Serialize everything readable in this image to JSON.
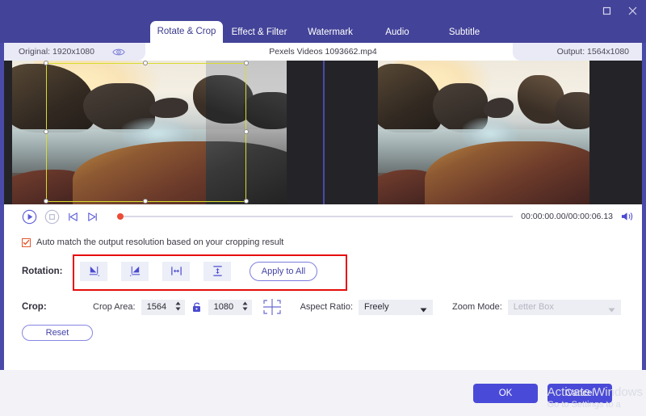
{
  "window": {
    "maximize_label": "Maximize",
    "close_label": "Close"
  },
  "tabs": [
    {
      "label": "Rotate & Crop",
      "active": true
    },
    {
      "label": "Effect & Filter",
      "active": false
    },
    {
      "label": "Watermark",
      "active": false
    },
    {
      "label": "Audio",
      "active": false
    },
    {
      "label": "Subtitle",
      "active": false
    }
  ],
  "preview": {
    "original_label": "Original: 1920x1080",
    "filename": "Pexels Videos 1093662.mp4",
    "output_label": "Output: 1564x1080",
    "eye_icon": "eye-icon"
  },
  "transport": {
    "play_icon": "play-icon",
    "stop_icon": "stop-icon",
    "prev_icon": "previous-frame-icon",
    "next_icon": "next-frame-icon",
    "timecode": "00:00:00.00/00:00:06.13",
    "volume_icon": "volume-icon"
  },
  "settings": {
    "auto_match_label": "Auto match the output resolution based on your cropping result",
    "auto_match_checked": true,
    "rotation_label": "Rotation:",
    "rotation_buttons": [
      {
        "name": "rotate-left-icon",
        "title": "Rotate Left"
      },
      {
        "name": "rotate-right-icon",
        "title": "Rotate Right"
      },
      {
        "name": "flip-horizontal-icon",
        "title": "Horizontal Flip"
      },
      {
        "name": "flip-vertical-icon",
        "title": "Vertical Flip"
      }
    ],
    "apply_to_all_label": "Apply to All",
    "crop_label": "Crop:",
    "crop_area_label": "Crop Area:",
    "crop_width": "1564",
    "crop_height": "1080",
    "lock_icon": "lock-icon",
    "position_icon": "crop-position-icon",
    "aspect_ratio_label": "Aspect Ratio:",
    "aspect_ratio_value": "Freely",
    "zoom_mode_label": "Zoom Mode:",
    "zoom_mode_value": "Letter Box",
    "zoom_mode_disabled": true,
    "reset_label": "Reset"
  },
  "footer": {
    "ok_label": "OK",
    "cancel_label": "Cancel"
  },
  "watermark": {
    "line1": "Activate Windows",
    "line2": "Go to Settings to a"
  },
  "colors": {
    "brand": "#434399",
    "accent": "#4a4ad8",
    "highlight_red": "#e60d0d",
    "crop_border": "#d8dc2e",
    "checkbox_border": "#e2572c"
  }
}
